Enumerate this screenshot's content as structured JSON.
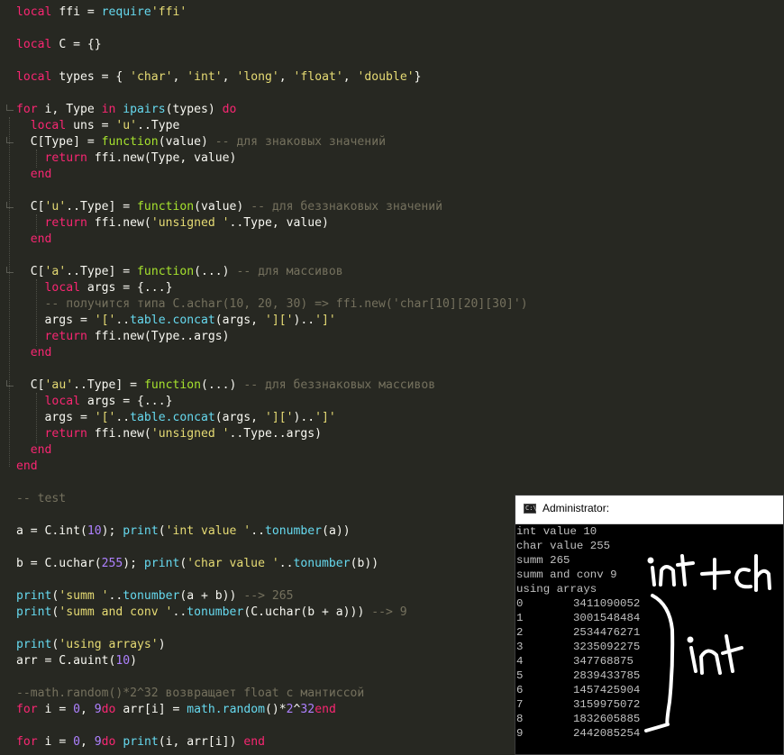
{
  "editor": {
    "lines": [
      {
        "tokens": [
          [
            "kw",
            "local"
          ],
          [
            "",
            "ffi = "
          ],
          [
            "bi",
            "require"
          ],
          [
            "str",
            "'ffi'"
          ]
        ]
      },
      {
        "tokens": []
      },
      {
        "tokens": [
          [
            "kw",
            "local"
          ],
          [
            "",
            "C = {}"
          ]
        ]
      },
      {
        "tokens": []
      },
      {
        "tokens": [
          [
            "kw",
            "local"
          ],
          [
            "",
            "types = { "
          ],
          [
            "str",
            "'char'"
          ],
          [
            "",
            ", "
          ],
          [
            "str",
            "'int'"
          ],
          [
            "",
            ", "
          ],
          [
            "str",
            "'long'"
          ],
          [
            "",
            ", "
          ],
          [
            "str",
            "'float'"
          ],
          [
            "",
            ", "
          ],
          [
            "str",
            "'double'"
          ],
          [
            "",
            "}"
          ]
        ]
      },
      {
        "tokens": []
      },
      {
        "tokens": [
          [
            "kw",
            "for"
          ],
          [
            "",
            "i, Type "
          ],
          [
            "kw",
            "in "
          ],
          [
            "bi",
            "ipairs"
          ],
          [
            "",
            "(types) "
          ],
          [
            "kw",
            "do"
          ]
        ]
      },
      {
        "tokens": [
          [
            "",
            "  "
          ],
          [
            "kw",
            "local"
          ],
          [
            "",
            "uns = "
          ],
          [
            "str",
            "'u'"
          ],
          [
            "",
            "..Type"
          ]
        ]
      },
      {
        "tokens": [
          [
            "",
            "  C[Type] = "
          ],
          [
            "fn",
            "function"
          ],
          [
            "",
            "(value) "
          ],
          [
            "cm",
            "-- для знаковых значений"
          ]
        ]
      },
      {
        "tokens": [
          [
            "",
            "    "
          ],
          [
            "kw",
            "return"
          ],
          [
            "",
            "ffi.new(Type, value)"
          ]
        ]
      },
      {
        "tokens": [
          [
            "",
            "  "
          ],
          [
            "kw",
            "end"
          ]
        ]
      },
      {
        "tokens": []
      },
      {
        "tokens": [
          [
            "",
            "  C["
          ],
          [
            "str",
            "'u'"
          ],
          [
            "",
            "..Type] = "
          ],
          [
            "fn",
            "function"
          ],
          [
            "",
            "(value) "
          ],
          [
            "cm",
            "-- для беззнаковых значений"
          ]
        ]
      },
      {
        "tokens": [
          [
            "",
            "    "
          ],
          [
            "kw",
            "return"
          ],
          [
            "",
            "ffi.new("
          ],
          [
            "str",
            "'unsigned '"
          ],
          [
            "",
            "..Type, value)"
          ]
        ]
      },
      {
        "tokens": [
          [
            "",
            "  "
          ],
          [
            "kw",
            "end"
          ]
        ]
      },
      {
        "tokens": []
      },
      {
        "tokens": [
          [
            "",
            "  C["
          ],
          [
            "str",
            "'a'"
          ],
          [
            "",
            "..Type] = "
          ],
          [
            "fn",
            "function"
          ],
          [
            "",
            "(...) "
          ],
          [
            "cm",
            "-- для массивов"
          ]
        ]
      },
      {
        "tokens": [
          [
            "",
            "    "
          ],
          [
            "kw",
            "local"
          ],
          [
            "",
            "args = {...}"
          ]
        ]
      },
      {
        "tokens": [
          [
            "",
            "    "
          ],
          [
            "cm",
            "-- получится типа C.achar(10, 20, 30) => ffi.new('char[10][20][30]')"
          ]
        ]
      },
      {
        "tokens": [
          [
            "",
            "    args = "
          ],
          [
            "str",
            "'['"
          ],
          [
            "",
            ".."
          ],
          [
            "bi",
            "table.concat"
          ],
          [
            "",
            "(args, "
          ],
          [
            "str",
            "']['"
          ],
          [
            "",
            ").."
          ],
          [
            "str",
            "']'"
          ]
        ]
      },
      {
        "tokens": [
          [
            "",
            "    "
          ],
          [
            "kw",
            "return"
          ],
          [
            "",
            "ffi.new(Type..args)"
          ]
        ]
      },
      {
        "tokens": [
          [
            "",
            "  "
          ],
          [
            "kw",
            "end"
          ]
        ]
      },
      {
        "tokens": []
      },
      {
        "tokens": [
          [
            "",
            "  C["
          ],
          [
            "str",
            "'au'"
          ],
          [
            "",
            "..Type] = "
          ],
          [
            "fn",
            "function"
          ],
          [
            "",
            "(...) "
          ],
          [
            "cm",
            "-- для беззнаковых массивов"
          ]
        ]
      },
      {
        "tokens": [
          [
            "",
            "    "
          ],
          [
            "kw",
            "local"
          ],
          [
            "",
            "args = {...}"
          ]
        ]
      },
      {
        "tokens": [
          [
            "",
            "    args = "
          ],
          [
            "str",
            "'['"
          ],
          [
            "",
            ".."
          ],
          [
            "bi",
            "table.concat"
          ],
          [
            "",
            "(args, "
          ],
          [
            "str",
            "']['"
          ],
          [
            "",
            ").."
          ],
          [
            "str",
            "']'"
          ]
        ]
      },
      {
        "tokens": [
          [
            "",
            "    "
          ],
          [
            "kw",
            "return"
          ],
          [
            "",
            "ffi.new("
          ],
          [
            "str",
            "'unsigned '"
          ],
          [
            "",
            "..Type..args)"
          ]
        ]
      },
      {
        "tokens": [
          [
            "",
            "  "
          ],
          [
            "kw",
            "end"
          ]
        ]
      },
      {
        "tokens": [
          [
            "kw",
            "end"
          ]
        ]
      },
      {
        "tokens": []
      },
      {
        "tokens": [
          [
            "cm",
            "-- test"
          ]
        ]
      },
      {
        "tokens": []
      },
      {
        "tokens": [
          [
            "",
            "a = C.int("
          ],
          [
            "num",
            "10"
          ],
          [
            "",
            "); "
          ],
          [
            "bi",
            "print"
          ],
          [
            "",
            "("
          ],
          [
            "str",
            "'int value '"
          ],
          [
            "",
            ".."
          ],
          [
            "bi",
            "tonumber"
          ],
          [
            "",
            "(a))"
          ]
        ]
      },
      {
        "tokens": []
      },
      {
        "tokens": [
          [
            "",
            "b = C.uchar("
          ],
          [
            "num",
            "255"
          ],
          [
            "",
            "); "
          ],
          [
            "bi",
            "print"
          ],
          [
            "",
            "("
          ],
          [
            "str",
            "'char value '"
          ],
          [
            "",
            ".."
          ],
          [
            "bi",
            "tonumber"
          ],
          [
            "",
            "(b))"
          ]
        ]
      },
      {
        "tokens": []
      },
      {
        "tokens": [
          [
            "bi",
            "print"
          ],
          [
            "",
            "("
          ],
          [
            "str",
            "'summ '"
          ],
          [
            "",
            ".."
          ],
          [
            "bi",
            "tonumber"
          ],
          [
            "",
            "(a + b)) "
          ],
          [
            "cm",
            "--> 265"
          ]
        ]
      },
      {
        "tokens": [
          [
            "bi",
            "print"
          ],
          [
            "",
            "("
          ],
          [
            "str",
            "'summ and conv '"
          ],
          [
            "",
            ".."
          ],
          [
            "bi",
            "tonumber"
          ],
          [
            "",
            "(C.uchar(b + a))) "
          ],
          [
            "cm",
            "--> 9"
          ]
        ]
      },
      {
        "tokens": []
      },
      {
        "tokens": [
          [
            "bi",
            "print"
          ],
          [
            "",
            "("
          ],
          [
            "str",
            "'using arrays'"
          ],
          [
            "",
            ")"
          ]
        ]
      },
      {
        "tokens": [
          [
            "",
            "arr = C.auint("
          ],
          [
            "num",
            "10"
          ],
          [
            "",
            ")"
          ]
        ]
      },
      {
        "tokens": []
      },
      {
        "tokens": [
          [
            "cm",
            "--math.random()*2^32 возвращает float с мантиссой"
          ]
        ]
      },
      {
        "tokens": [
          [
            "kw",
            "for"
          ],
          [
            "",
            "i = "
          ],
          [
            "num",
            "0"
          ],
          [
            "",
            ", "
          ],
          [
            "num",
            "9"
          ],
          [
            "",
            ""
          ],
          [
            "kw",
            "do"
          ],
          [
            "",
            "arr[i] = "
          ],
          [
            "bi",
            "math.random"
          ],
          [
            "",
            "()*"
          ],
          [
            "num",
            "2"
          ],
          [
            "",
            "^"
          ],
          [
            "num",
            "32"
          ],
          [
            "",
            ""
          ],
          [
            "kw",
            "end"
          ]
        ]
      },
      {
        "tokens": []
      },
      {
        "tokens": [
          [
            "kw",
            "for"
          ],
          [
            "",
            "i = "
          ],
          [
            "num",
            "0"
          ],
          [
            "",
            ", "
          ],
          [
            "num",
            "9"
          ],
          [
            "",
            ""
          ],
          [
            "kw",
            "do"
          ],
          [
            "",
            ""
          ],
          [
            "bi",
            "print"
          ],
          [
            "",
            "(i, arr[i]) "
          ],
          [
            "kw",
            "end"
          ]
        ]
      }
    ]
  },
  "console": {
    "title": "Administrator:",
    "icon": "console-window-icon",
    "icon_text": "C:\\",
    "header_lines": [
      "int value 10",
      "char value 255",
      "summ 265",
      "summ and conv 9",
      "using arrays"
    ],
    "rows": [
      {
        "i": "0",
        "v": "3411090052"
      },
      {
        "i": "1",
        "v": "3001548484"
      },
      {
        "i": "2",
        "v": "2534476271"
      },
      {
        "i": "3",
        "v": "3235092275"
      },
      {
        "i": "4",
        "v": "347768875"
      },
      {
        "i": "5",
        "v": "2839433785"
      },
      {
        "i": "6",
        "v": "1457425904"
      },
      {
        "i": "7",
        "v": "3159975072"
      },
      {
        "i": "8",
        "v": "1832605885"
      },
      {
        "i": "9",
        "v": "2442085254"
      }
    ]
  },
  "annotations": {
    "top_handwriting": "int + ch",
    "side_handwriting": "int"
  },
  "colors": {
    "background": "#272822",
    "keyword": "#f92672",
    "string": "#e6db74",
    "number": "#ae81ff",
    "function": "#a6e22e",
    "builtin": "#66d9ef",
    "comment": "#75715e",
    "text": "#f8f8f2",
    "console_bg": "#000000",
    "console_text": "#c0c0c0"
  }
}
